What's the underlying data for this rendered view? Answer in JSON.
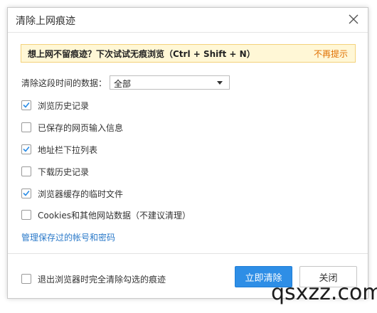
{
  "dialog": {
    "title": "清除上网痕迹",
    "close_icon": "close-icon"
  },
  "banner": {
    "text": "想上网不留痕迹？下次试试无痕浏览（Ctrl + Shift + N）",
    "dismiss_label": "不再提示"
  },
  "range": {
    "label": "清除这段时间的数据：",
    "selected": "全部"
  },
  "options": [
    {
      "label": "浏览历史记录",
      "checked": true
    },
    {
      "label": "已保存的网页输入信息",
      "checked": false
    },
    {
      "label": "地址栏下拉列表",
      "checked": true
    },
    {
      "label": "下载历史记录",
      "checked": false
    },
    {
      "label": "浏览器缓存的临时文件",
      "checked": true
    },
    {
      "label": "Cookies和其他网站数据（不建议清理）",
      "checked": false
    }
  ],
  "manage_link": "管理保存过的帐号和密码",
  "footer": {
    "exit_clear_label": "退出浏览器时完全清除勾选的痕迹",
    "exit_clear_checked": false,
    "confirm_label": "立即清除",
    "close_label": "关闭"
  },
  "watermark": "qsxzz.com",
  "colors": {
    "accent": "#2e8ee6",
    "link": "#2a79c9",
    "banner_bg": "#fff7d6",
    "banner_border": "#f4d27a",
    "banner_link": "#e07000",
    "check": "#2e8ee6"
  }
}
